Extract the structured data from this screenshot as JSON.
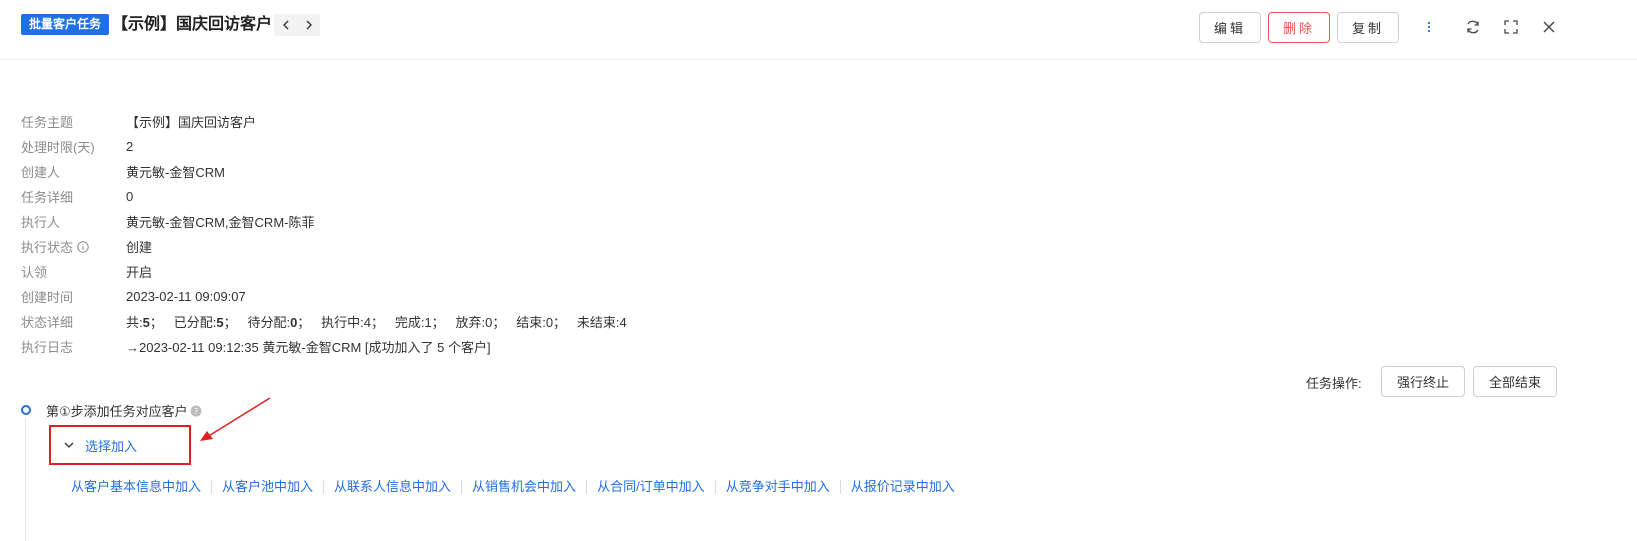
{
  "header": {
    "tag": "批量客户任务",
    "title": "【示例】国庆回访客户",
    "edit_label": "编辑",
    "delete_label": "删除",
    "copy_label": "复制",
    "icons": [
      "chevron-left-icon",
      "chevron-right-icon",
      "more-vertical-icon",
      "refresh-icon",
      "fullscreen-icon",
      "close-icon"
    ]
  },
  "info": {
    "rows": [
      {
        "label": "任务主题",
        "value": "【示例】国庆回访客户"
      },
      {
        "label": "处理时限(天)",
        "value": "2"
      },
      {
        "label": "创建人",
        "value": "黄元敏-金智CRM"
      },
      {
        "label": "任务详细",
        "value": "0"
      },
      {
        "label": "执行人",
        "value": "黄元敏-金智CRM,金智CRM-陈菲"
      },
      {
        "label": "执行状态",
        "value": "创建"
      },
      {
        "label": "认领",
        "value": "开启"
      },
      {
        "label": "创建时间",
        "value": "2023-02-11 09:09:07"
      },
      {
        "label": "状态详细",
        "value": ""
      },
      {
        "label": "执行日志",
        "value": "→2023-02-11 09:12:35 黄元敏-金智CRM [成功加入了 5 个客户]"
      }
    ],
    "status_detail": {
      "total_label": "共:",
      "total": "5",
      "assigned_label": "已分配:",
      "assigned": "5",
      "pending_label": "待分配:",
      "pending": "0",
      "running": "执行中:4；",
      "done": "完成:1；",
      "abandoned": "放弃:0；",
      "ended": "结束:0；",
      "unended": "未结束:4"
    }
  },
  "ops": {
    "label": "任务操作:",
    "terminate_label": "强行终止",
    "finish_label": "全部结束"
  },
  "step": {
    "title": "第①步添加任务对应客户",
    "select_label": "选择加入",
    "links": [
      "从客户基本信息中加入",
      "从客户池中加入",
      "从联系人信息中加入",
      "从销售机会中加入",
      "从合同/订单中加入",
      "从竞争对手中加入",
      "从报价记录中加入"
    ]
  },
  "colors": {
    "accent": "#1f6fe5",
    "danger": "#f05454",
    "annotation": "#e02020"
  }
}
